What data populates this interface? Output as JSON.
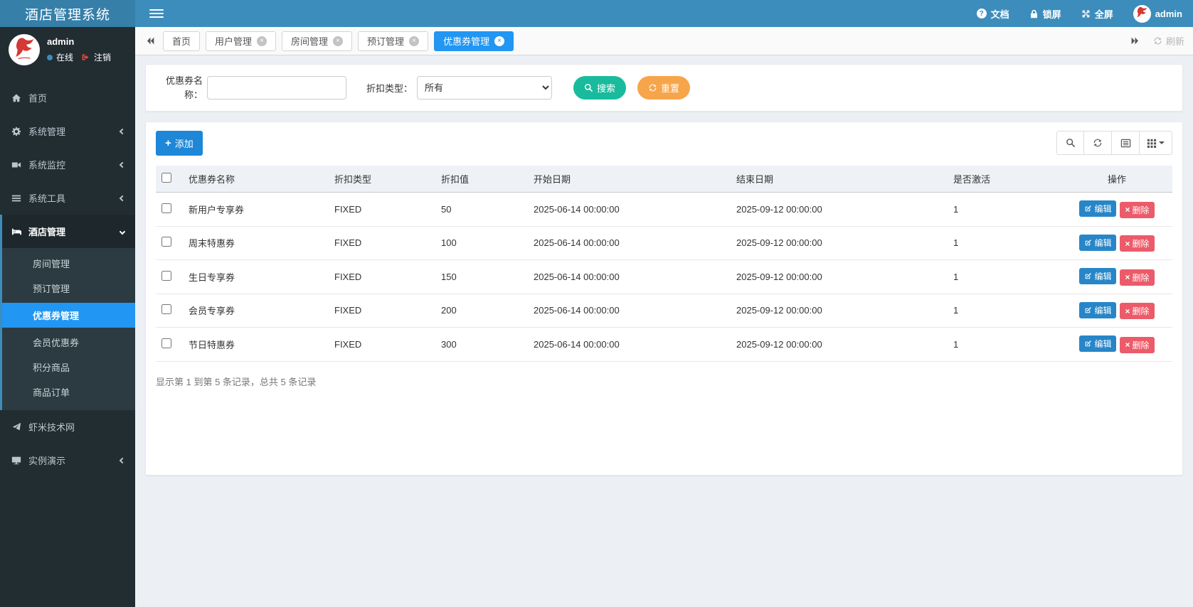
{
  "app": {
    "title": "酒店管理系统"
  },
  "colors": {
    "navbar": "#3c8dbc",
    "logo": "#367fa9",
    "accent": "#2196f3",
    "primary": "#1e87d8",
    "success": "#18bc9c",
    "warning": "#f7a54a",
    "danger": "#ec5b69",
    "edit": "#2786c8"
  },
  "navbar": {
    "docs": "文档",
    "lock": "锁屏",
    "fullscreen": "全屏",
    "username": "admin"
  },
  "user_panel": {
    "name": "admin",
    "status": "在线",
    "logout": "注销"
  },
  "sidebar": {
    "home": "首页",
    "system_mgmt": "系统管理",
    "system_monitor": "系统监控",
    "system_tools": "系统工具",
    "hotel_mgmt": "酒店管理",
    "hotel_children": {
      "rooms": "房间管理",
      "booking": "预订管理",
      "coupon": "优惠券管理",
      "member_coupon": "会员优惠券",
      "points_goods": "积分商品",
      "goods_order": "商品订单"
    },
    "xiami": "虾米技术网",
    "demo": "实例演示"
  },
  "tabs": {
    "items": [
      {
        "label": "首页"
      },
      {
        "label": "用户管理"
      },
      {
        "label": "房间管理"
      },
      {
        "label": "预订管理"
      },
      {
        "label": "优惠券管理"
      }
    ],
    "refresh": "刷新"
  },
  "search": {
    "name_label": "优惠券名称：",
    "type_label": "折扣类型：",
    "type_value": "所有",
    "search_label": "搜索",
    "reset_label": "重置"
  },
  "toolbar": {
    "add_label": "添加"
  },
  "table": {
    "columns": [
      "优惠券名称",
      "折扣类型",
      "折扣值",
      "开始日期",
      "结束日期",
      "是否激活",
      "操作"
    ],
    "edit_label": "编辑",
    "delete_label": "删除",
    "rows": [
      {
        "name": "新用户专享券",
        "type": "FIXED",
        "value": "50",
        "start": "2025-06-14 00:00:00",
        "end": "2025-09-12 00:00:00",
        "active": "1"
      },
      {
        "name": "周末特惠券",
        "type": "FIXED",
        "value": "100",
        "start": "2025-06-14 00:00:00",
        "end": "2025-09-12 00:00:00",
        "active": "1"
      },
      {
        "name": "生日专享券",
        "type": "FIXED",
        "value": "150",
        "start": "2025-06-14 00:00:00",
        "end": "2025-09-12 00:00:00",
        "active": "1"
      },
      {
        "name": "会员专享券",
        "type": "FIXED",
        "value": "200",
        "start": "2025-06-14 00:00:00",
        "end": "2025-09-12 00:00:00",
        "active": "1"
      },
      {
        "name": "节日特惠券",
        "type": "FIXED",
        "value": "300",
        "start": "2025-06-14 00:00:00",
        "end": "2025-09-12 00:00:00",
        "active": "1"
      }
    ],
    "summary": "显示第 1 到第 5 条记录，总共 5 条记录"
  }
}
